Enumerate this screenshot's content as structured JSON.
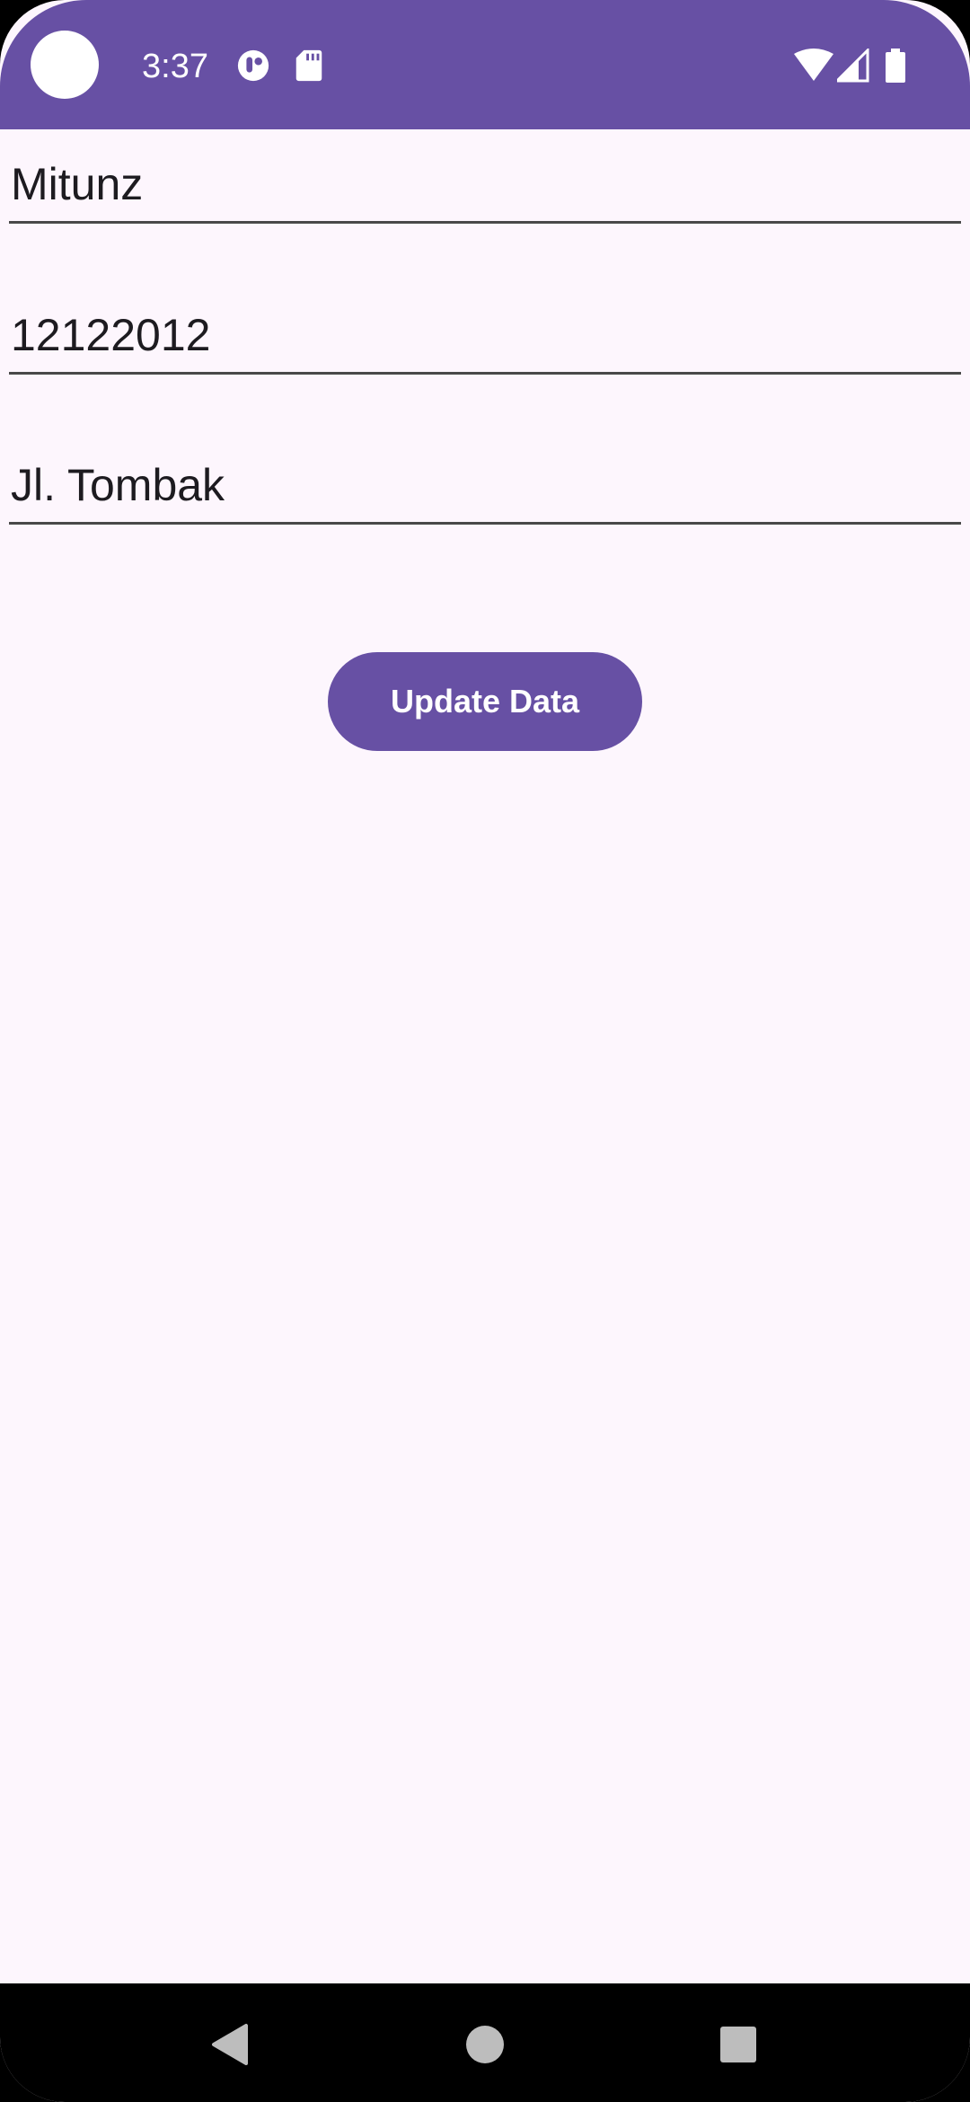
{
  "status_bar": {
    "time": "3:37",
    "icons": [
      "app-notification-icon",
      "sd-card-icon",
      "wifi-icon",
      "signal-icon",
      "battery-icon"
    ],
    "background_color": "#6750a4"
  },
  "form": {
    "name_value": "Mitunz",
    "number_value": "12122012",
    "address_value": "Jl. Tombak"
  },
  "actions": {
    "update_label": "Update Data",
    "button_color": "#6750a4"
  },
  "nav_bar": {
    "icons": [
      "back-icon",
      "home-icon",
      "recents-icon"
    ]
  }
}
